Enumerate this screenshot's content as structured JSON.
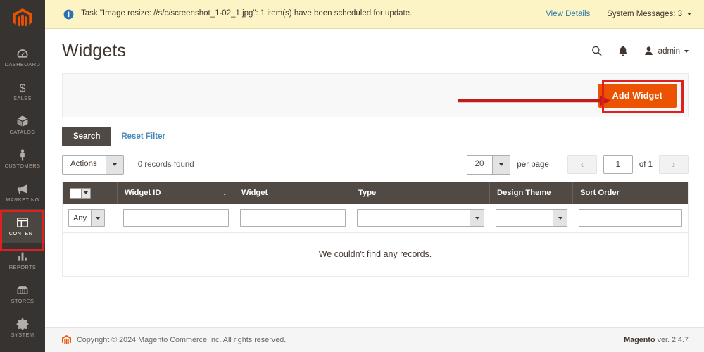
{
  "colors": {
    "sidebar_bg": "#373330",
    "sidebar_active_bg": "#4c4640",
    "accent_orange": "#eb5202",
    "annotation_red": "#e02020",
    "grid_header_bg": "#514943",
    "notice_bg": "#fdf4c6",
    "link_blue": "#4a8bbd"
  },
  "sidebar": {
    "logo_name": "magento-logo-icon",
    "items": [
      {
        "label": "DASHBOARD",
        "icon": "dashboard-icon",
        "active": false
      },
      {
        "label": "SALES",
        "icon": "dollar-icon",
        "active": false
      },
      {
        "label": "CATALOG",
        "icon": "box-icon",
        "active": false
      },
      {
        "label": "CUSTOMERS",
        "icon": "person-icon",
        "active": false
      },
      {
        "label": "MARKETING",
        "icon": "megaphone-icon",
        "active": false
      },
      {
        "label": "CONTENT",
        "icon": "layout-icon",
        "active": true
      },
      {
        "label": "REPORTS",
        "icon": "bar-chart-icon",
        "active": false
      },
      {
        "label": "STORES",
        "icon": "store-icon",
        "active": false
      },
      {
        "label": "SYSTEM",
        "icon": "gear-icon",
        "active": false
      }
    ]
  },
  "notice": {
    "icon": "info-icon",
    "message": "Task \"Image resize: //s/c/screenshot_1-02_1.jpg\": 1 item(s) have been scheduled for update.",
    "view_details": "View Details",
    "system_messages": "System Messages: 3"
  },
  "header": {
    "title": "Widgets",
    "search_icon": "search-icon",
    "notifications_icon": "bell-icon",
    "user_icon": "user-avatar-icon",
    "user_name": "admin"
  },
  "action_bar": {
    "add_widget_label": "Add Widget"
  },
  "filters": {
    "search_label": "Search",
    "reset_label": "Reset Filter"
  },
  "tools": {
    "actions_label": "Actions",
    "records_found": "0 records found",
    "per_page_value": "20",
    "per_page_label": "per page",
    "current_page": "1",
    "of_pages": "of 1",
    "prev_glyph": "‹",
    "next_glyph": "›"
  },
  "grid": {
    "columns": [
      {
        "label": "",
        "name": "massaction"
      },
      {
        "label": "Widget ID",
        "name": "widget-id",
        "sorted": true,
        "sort_glyph": "↓"
      },
      {
        "label": "Widget",
        "name": "widget"
      },
      {
        "label": "Type",
        "name": "type"
      },
      {
        "label": "Design Theme",
        "name": "design-theme"
      },
      {
        "label": "Sort Order",
        "name": "sort-order"
      }
    ],
    "filter_values": {
      "massaction": "Any",
      "widget_id": "",
      "widget": "",
      "type": "",
      "design_theme": "",
      "sort_order": ""
    },
    "empty_message": "We couldn't find any records."
  },
  "footer": {
    "copyright": "Copyright © 2024 Magento Commerce Inc. All rights reserved.",
    "brand": "Magento",
    "version": "ver. 2.4.7"
  }
}
